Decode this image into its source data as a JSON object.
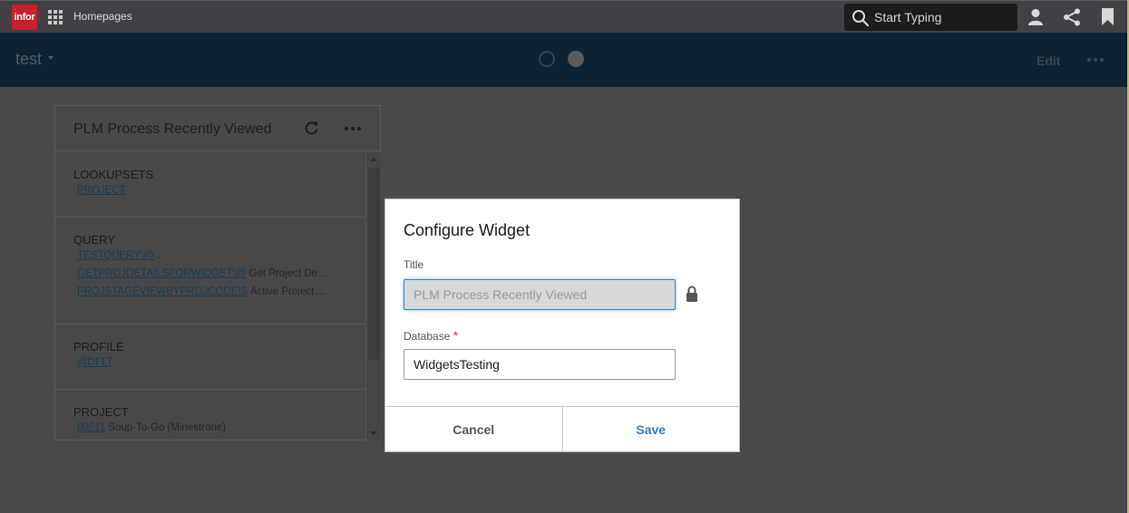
{
  "appbar": {
    "logo_text": "infor",
    "app_title": "Homepages",
    "search_placeholder": "Start Typing",
    "icons": [
      "apps-grid-icon",
      "search-icon",
      "user-icon",
      "share-icon",
      "bookmark-icon"
    ]
  },
  "pagebar": {
    "title": "test",
    "page_count": 2,
    "active_page": 2,
    "edit_label": "Edit"
  },
  "widget": {
    "title": "PLM Process Recently Viewed",
    "sections": [
      {
        "heading": "LOOKUPSETS",
        "rows": [
          {
            "link": "PROJECT",
            "desc": ""
          }
        ]
      },
      {
        "heading": "QUERY",
        "rows": [
          {
            "link": "TESTQUERY\\@",
            "desc": "."
          },
          {
            "link": "GETPROJDETAILSFORWIDGET\\@",
            "desc": "Get Project De..."
          },
          {
            "link": "PROJSTAGEVIEWBYPROJCODE\\S",
            "desc": "Active Project ..."
          }
        ]
      },
      {
        "heading": "PROFILE",
        "rows": [
          {
            "link": "@DFLT",
            "desc": "."
          }
        ]
      },
      {
        "heading": "PROJECT",
        "rows": [
          {
            "link": "00011",
            "desc": "Soup-To-Go (Minestrone)"
          }
        ]
      }
    ]
  },
  "dialog": {
    "title": "Configure Widget",
    "title_field": {
      "label": "Title",
      "value": "PLM Process Recently Viewed",
      "locked": true
    },
    "database_field": {
      "label": "Database",
      "required_mark": "*",
      "value": "WidgetsTesting"
    },
    "cancel_label": "Cancel",
    "save_label": "Save"
  },
  "colors": {
    "brand": "#c8202e",
    "accent": "#2f7fc1",
    "required": "#dd3333"
  }
}
